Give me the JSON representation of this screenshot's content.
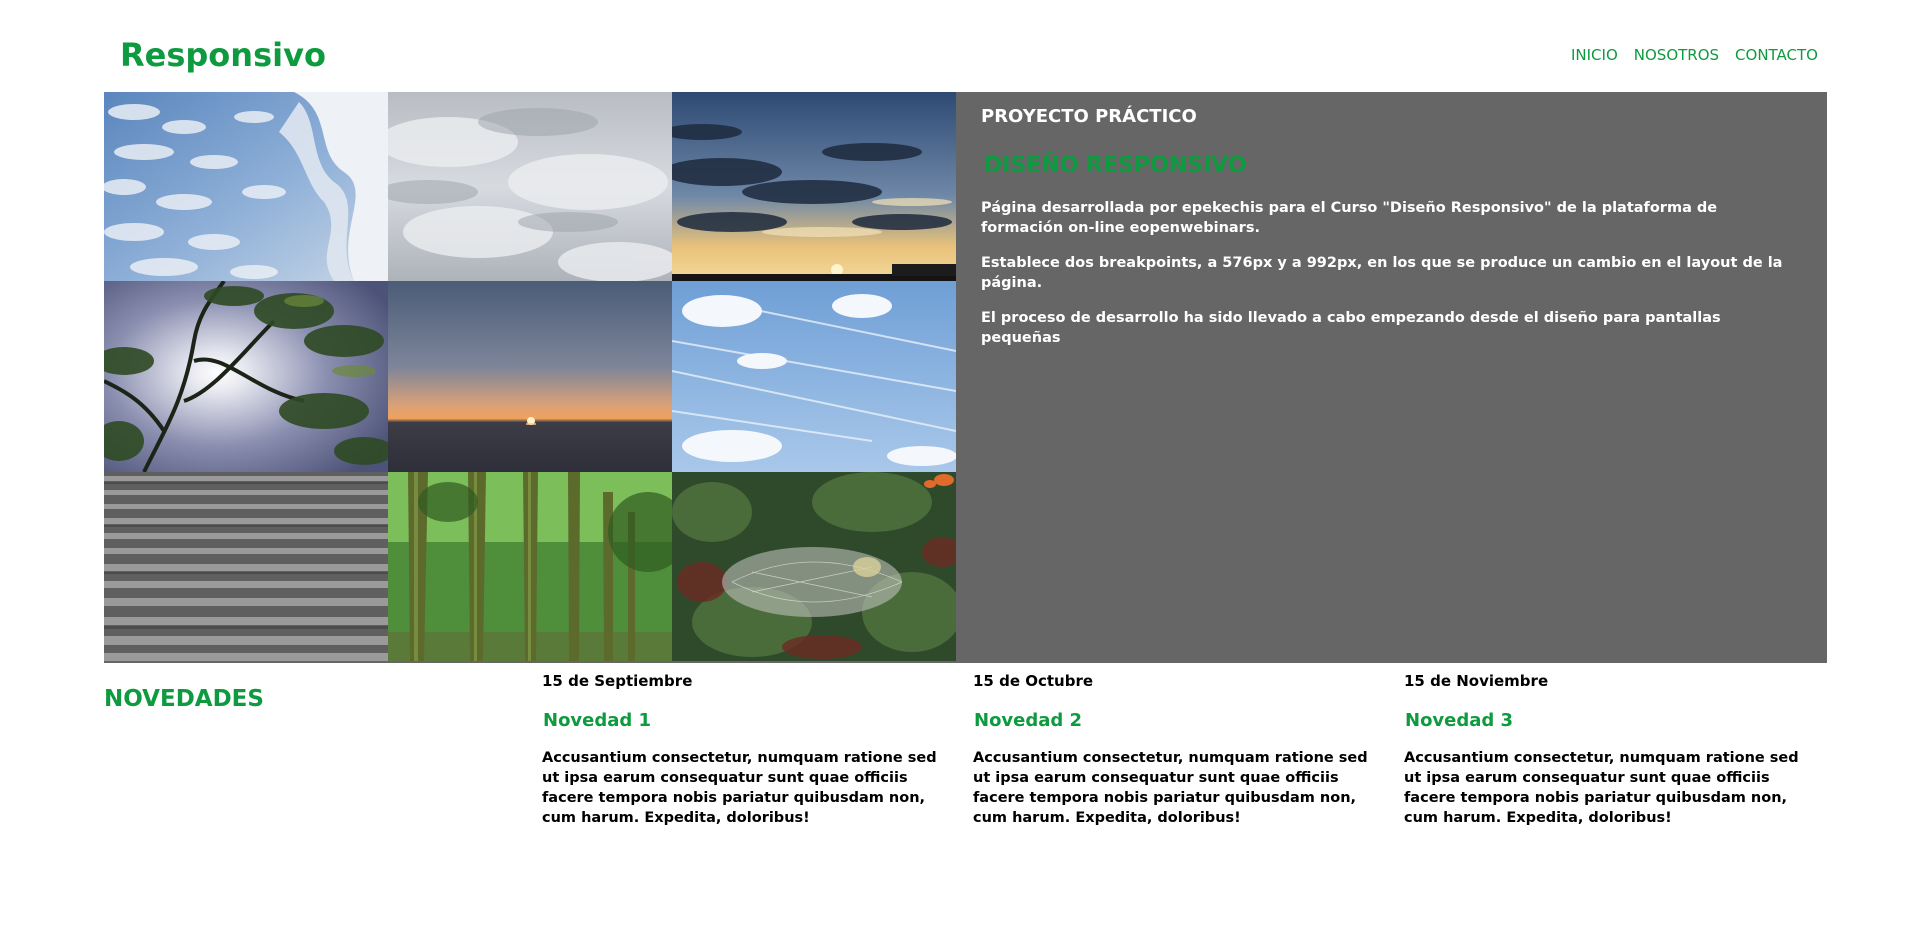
{
  "header": {
    "logo": "Responsivo",
    "nav": [
      "INICIO",
      "NOSOTROS",
      "CONTACTO"
    ]
  },
  "colors": {
    "brand_green": "#0e9a3e",
    "hero_bg": "#666666"
  },
  "gallery": {
    "photos": [
      "altocumulus-clouds-photo",
      "overcast-sky-photo",
      "sunset-clouds-photo",
      "tree-branches-sun-photo",
      "sea-sunset-photo",
      "contrail-sky-photo",
      "stone-stairs-photo",
      "forest-trees-photo",
      "spiderweb-plants-photo"
    ]
  },
  "hero": {
    "kicker": "PROYECTO PRÁCTICO",
    "title": "DISEÑO RESPONSIVO",
    "paragraphs": [
      "Página desarrollada por epekechis para el Curso \"Diseño Responsivo\" de la plataforma de formación on-line eopenwebinars.",
      "Establece dos breakpoints, a 576px y a 992px, en los que se produce un cambio en el layout de la página.",
      "El proceso de desarrollo ha sido llevado a cabo empezando desde el diseño para pantallas pequeñas"
    ]
  },
  "news": {
    "heading": "NOVEDADES",
    "items": [
      {
        "date": "15 de Septiembre",
        "title": "Novedad 1",
        "body": "Accusantium consectetur, numquam ratione sed ut ipsa earum consequatur sunt quae officiis facere tempora nobis pariatur quibusdam non, cum harum. Expedita, doloribus!"
      },
      {
        "date": "15 de Octubre",
        "title": "Novedad 2",
        "body": "Accusantium consectetur, numquam ratione sed ut ipsa earum consequatur sunt quae officiis facere tempora nobis pariatur quibusdam non, cum harum. Expedita, doloribus!"
      },
      {
        "date": "15 de Noviembre",
        "title": "Novedad 3",
        "body": "Accusantium consectetur, numquam ratione sed ut ipsa earum consequatur sunt quae officiis facere tempora nobis pariatur quibusdam non, cum harum. Expedita, doloribus!"
      }
    ]
  }
}
